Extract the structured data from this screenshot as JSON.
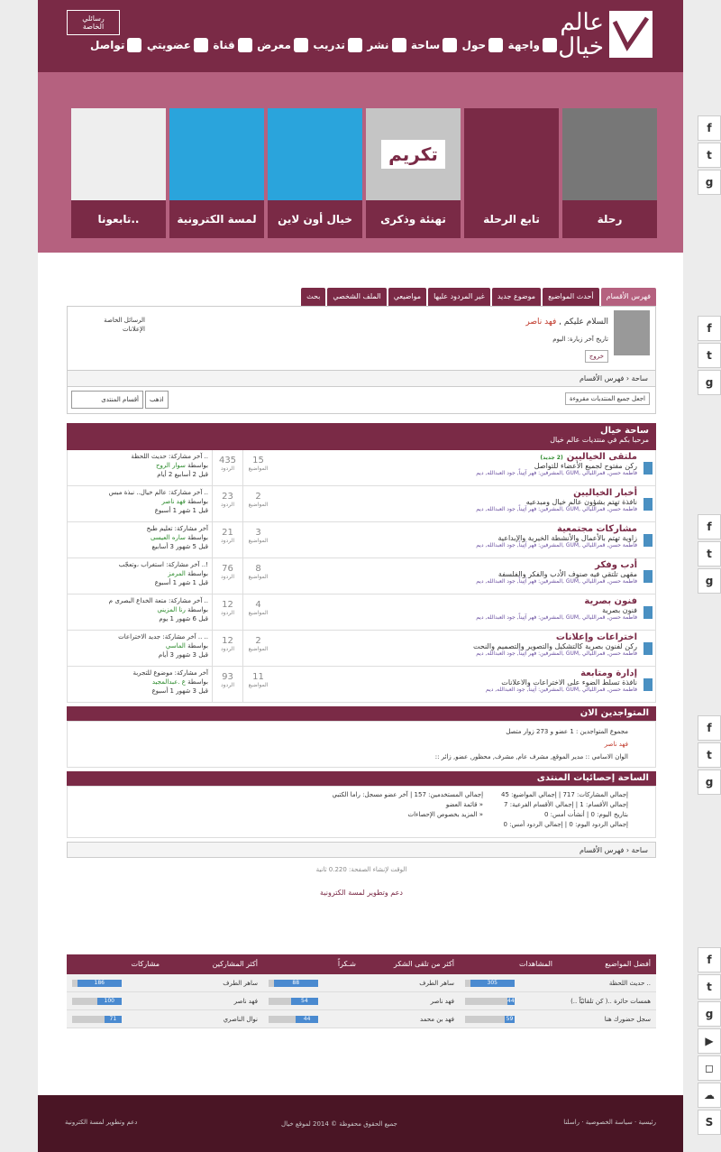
{
  "header": {
    "logo_text": "عالم خيال",
    "pm_button": "رسائلي الخاصة",
    "nav": [
      "واجهة",
      "حول",
      "ساحة",
      "نشر",
      "تدريب",
      "معرض",
      "قناة",
      "عضويتي",
      "تواصل"
    ]
  },
  "banner": {
    "tiles": [
      {
        "label": "رحلة"
      },
      {
        "label": "تابع الرحلة"
      },
      {
        "label": "تهنئة وذكرى",
        "image_text": "تكريم"
      },
      {
        "label": "خيال أون لاين"
      },
      {
        "label": "لمسة الكترونية"
      },
      {
        "label": "تابعونا.."
      }
    ]
  },
  "tabs": [
    "فهرس الأقسام",
    "أحدث المواضيع",
    "موضوع جديد",
    "غير المردود عليها",
    "مواضيعي",
    "الملف الشخصي",
    "بحث"
  ],
  "welcome": {
    "greeting": "السلام عليكم ,",
    "user": "فهد ناصر",
    "last_visit": "تاريخ آخر زيارة: اليوم",
    "logout": "خروج",
    "pm_link": "الرسائل الخاصة",
    "ann_link": "الإعلانات"
  },
  "breadcrumb": {
    "home": "ساحة",
    "current": "فهرس الأقسام"
  },
  "tools": {
    "mark_read": "اجعل جميع المنتديات مقروءة",
    "jump_select": "أقسام المنتدى",
    "jump_go": "اذهب"
  },
  "category": {
    "title": "ساحة خيال",
    "desc": "مرحبا بكم في منتديات عالم خيال"
  },
  "forums": [
    {
      "title": "ملتقى الخياليين",
      "badge": "(2 جديد)",
      "desc": "ركن مفتوح لجميع الأعضاء للتواصل",
      "mods": "المشرفين: فهر آتِيناً, جود العبدالله, ديم, GUM, فاطمة حسن, قمرالليالي",
      "topics": "15",
      "posts": "435",
      "last_title": "آخر مشاركة: حديث اللحظة ..",
      "last_by": "سوار الروح",
      "last_time": "قبل 2 أسابيع 2 أيام"
    },
    {
      "title": "أخبار الخياليين",
      "badge": "",
      "desc": "نافذة تهتم بشؤون عالم خيال ومبدعيه",
      "mods": "المشرفين: فهر آتِيناً, جود العبدالله, ديم, GUM, فاطمة حسن, قمرالليالي",
      "topics": "2",
      "posts": "23",
      "last_title": "آخر مشاركة: عالم خيال.. نبذة مبس ..",
      "last_by": "فهد ناصر",
      "last_time": "قبل 1 شهر 1 أسبوع"
    },
    {
      "title": "مشاركات مجتمعية",
      "badge": "",
      "desc": "زاوية تهتم بالأعمال والأنشطة الخيرية والإبداعية",
      "mods": "المشرفين: فهر آتِيناً, جود العبدالله, ديم, GUM, فاطمة حسن, قمرالليالي",
      "topics": "3",
      "posts": "21",
      "last_title": "آخر مشاركة: تعليم طبخ",
      "last_by": "ساره العيسى",
      "last_time": "قبل 5 شهور 3 أسابيع"
    },
    {
      "title": "أدب وفكر",
      "badge": "",
      "desc": "مقهى تلتقي فيه صنوف الأدب والفكر والفلسفة",
      "mods": "المشرفين: فهر آتِيناً, جود العبدالله, ديم, GUM, فاطمة حسن, قمرالليالي",
      "topics": "8",
      "posts": "76",
      "last_title": "آخر مشاركة: استغراب ،وتعجّب ..!",
      "last_by": "المرمز",
      "last_time": "قبل 1 شهر 1 أسبوع"
    },
    {
      "title": "فنون بصرية",
      "badge": "",
      "desc": "فنون بصرية",
      "mods": "المشرفين: فهر آتِيناً, جود العبدالله, ديم, GUM, فاطمة حسن, قمرالليالي",
      "topics": "4",
      "posts": "12",
      "last_title": "آخر مشاركة: متعة الخداع البصرى م ..",
      "last_by": "رنا المزيني",
      "last_time": "قبل 6 شهور 1 يوم"
    },
    {
      "title": "اختراعات وإعلانات",
      "badge": "",
      "desc": "ركن لفنون بصرية كالتشكيل والتصوير والتصميم والنحت",
      "mods": "المشرفين: فهر آتِيناً, جود العبدالله, ديم, GUM, فاطمة حسن, قمرالليالي",
      "topics": "2",
      "posts": "12",
      "last_title": "آخر مشاركة: جديد الاختراعات .. ..",
      "last_by": "الماسي",
      "last_time": "قبل 3 شهور 3 أيام"
    },
    {
      "title": "إدارة ومتابعة",
      "badge": "",
      "desc": "نافذة تسلط الضوء على الاختراعات والاعلانات",
      "mods": "المشرفين: آتِيناً, جود العبدالله, ديم, GUM, فاطمة حسن, قمرالليالي",
      "topics": "11",
      "posts": "93",
      "last_title": "آخر مشاركة: موضوع للتجربة",
      "last_by": "ع .عبدالمجيد",
      "last_time": "قبل 3 شهور 1 أسبوع"
    }
  ],
  "labels": {
    "topics": "المواضيع",
    "posts": "الردود",
    "by": "بواسطة"
  },
  "online": {
    "title": "المتواجدين الان",
    "total": "مجموع المتواجدين : 1 عضو و 273 زوار متصل",
    "user": "فهد ناصر",
    "legend": ":: الوان الاسامي :: مدير الموقع, مشرف عام, مشرف, محظور, عضو, زائر"
  },
  "stats": {
    "title": "الساحة إحصائيات المنتدى",
    "col1": [
      "إجمالي المشاركات: 717 | إجمالي المواضيع: 45",
      "إجمالي الأقسام: 1 | إجمالي الأقسام الفرعية: 7",
      "بتاريخ اليوم: 0 | أنشأت أمس: 0",
      "إجمالي الردود اليوم: 0 | إجمالي الردود أمس: 0"
    ],
    "col2": [
      "إجمالي المستخدمين: 157 | آخر عضو مسجل: راما الكتبي",
      "قائمة العضو »",
      "المزيد بخصوص الإحصاءات »"
    ]
  },
  "footer_info": "الوقت لإنشاء الصفحة: 0.220 ثانية",
  "credit": "دعم وتطوير لمسة الكترونية",
  "top_table": {
    "headers": [
      "أفضل المواضيع",
      "المشاهدات",
      "أكثر من تلقى الشكر",
      "شـكراً",
      "أكثر المشاركين",
      "مشاركات"
    ],
    "rows": [
      {
        "topic": "حديث اللحظة ..",
        "views": "305",
        "thanked": "ساهر الطرف",
        "thanks": "88",
        "poster": "ساهر الطرف",
        "posts": "186"
      },
      {
        "topic": "همسات حائرة ..( كن تلقائيّاً ..)",
        "views": "44",
        "thanked": "فهد ناصر",
        "thanks": "54",
        "poster": "فهد ناصر",
        "posts": "100"
      },
      {
        "topic": "سجل حضورك هنا",
        "views": "59",
        "thanked": "فهد بن محمد",
        "thanks": "44",
        "poster": "نوال الناصري",
        "posts": "71"
      }
    ],
    "fractions": [
      [
        0.9,
        0.9,
        0.9
      ],
      [
        0.15,
        0.55,
        0.5
      ],
      [
        0.2,
        0.45,
        0.35
      ]
    ]
  },
  "footer": {
    "links": "رئيسية · سياسة الخصوصية · راسلنا",
    "copyright": "جميع الحقوق محفوظة © 2014 لموقع خيال",
    "credit": "دعم وتطوير لمسة الكترونية"
  }
}
